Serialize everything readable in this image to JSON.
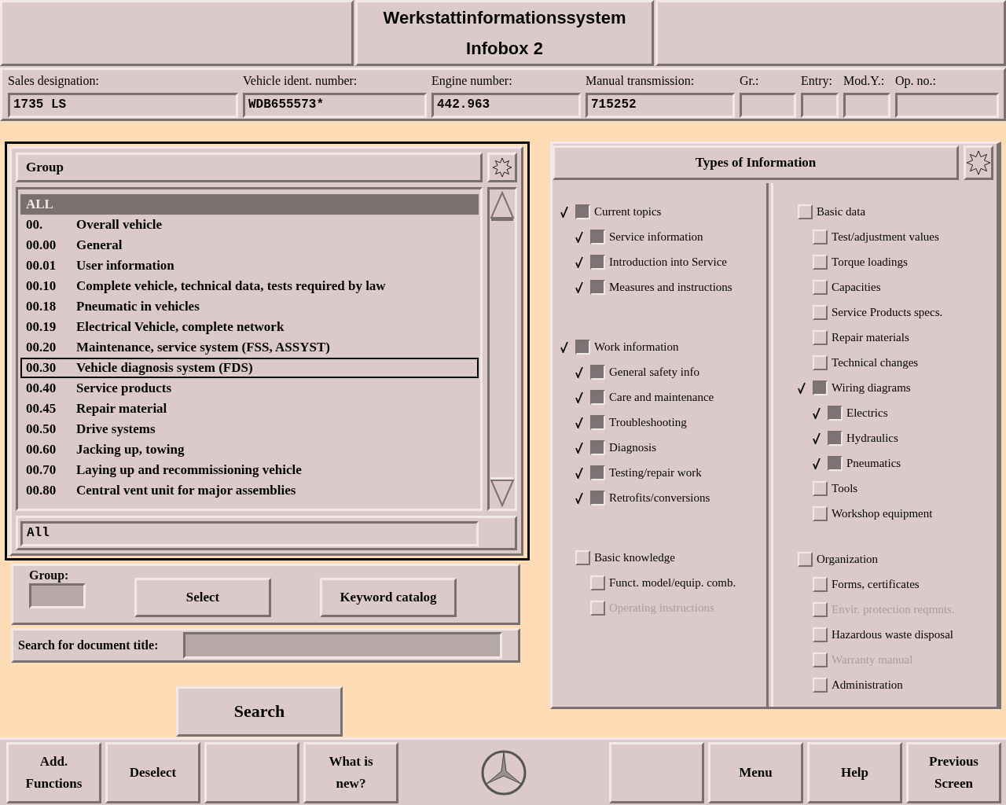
{
  "header": {
    "title": "Werkstattinformationssystem",
    "subtitle": "Infobox 2"
  },
  "vehicle_fields": [
    {
      "label": "Sales designation:",
      "value": "1735 LS"
    },
    {
      "label": "Vehicle ident. number:",
      "value": "WDB655573*"
    },
    {
      "label": "Engine number:",
      "value": "442.963"
    },
    {
      "label": "Manual transmission:",
      "value": "715252"
    },
    {
      "label": "Gr.:"
    },
    {
      "label": "Entry:"
    },
    {
      "label": "Mod.Y.:"
    },
    {
      "label": "Op. no.:"
    }
  ],
  "group_list": {
    "header": "Group",
    "filter_value": "All",
    "items": [
      {
        "code": "ALL",
        "selected": true,
        "focused": false
      },
      {
        "code": "00.",
        "title": "Overall vehicle",
        "selected": false,
        "focused": false
      },
      {
        "code": "00.00",
        "title": "General",
        "selected": false,
        "focused": false
      },
      {
        "code": "00.01",
        "title": "User information",
        "selected": false,
        "focused": false
      },
      {
        "code": "00.10",
        "title": "Complete vehicle, technical data, tests required by law",
        "selected": false,
        "focused": false
      },
      {
        "code": "00.18",
        "title": "Pneumatic in vehicles",
        "selected": false,
        "focused": false
      },
      {
        "code": "00.19",
        "title": "Electrical Vehicle, complete network",
        "selected": false,
        "focused": false
      },
      {
        "code": "00.20",
        "title": "Maintenance, service system (FSS, ASSYST)",
        "selected": false,
        "focused": false
      },
      {
        "code": "00.30",
        "title": "Vehicle diagnosis system (FDS)",
        "selected": false,
        "focused": true
      },
      {
        "code": "00.40",
        "title": "Service products",
        "selected": false,
        "focused": false
      },
      {
        "code": "00.45",
        "title": "Repair material",
        "selected": false,
        "focused": false
      },
      {
        "code": "00.50",
        "title": "Drive systems",
        "selected": false,
        "focused": false
      },
      {
        "code": "00.60",
        "title": "Jacking up, towing",
        "selected": false,
        "focused": false
      },
      {
        "code": "00.70",
        "title": "Laying up and recommissioning vehicle",
        "selected": false,
        "focused": false
      },
      {
        "code": "00.80",
        "title": "Central vent unit for major assemblies",
        "selected": false,
        "focused": false
      }
    ]
  },
  "group_controls": {
    "group_label": "Group:",
    "buttons": [
      "Select",
      "Keyword catalog"
    ]
  },
  "title_search": {
    "label": "Search for document title:"
  },
  "search_button": "Search",
  "info_types": {
    "title": "Types of Information",
    "columns": [
      {
        "items": [
          {
            "label": "Current topics",
            "checked": true,
            "disabled": false,
            "children": [
              {
                "label": "Service information",
                "checked": true,
                "disabled": false
              },
              {
                "label": "Introduction into Service",
                "checked": true,
                "disabled": false
              },
              {
                "label": "Measures and instructions",
                "checked": true,
                "disabled": false
              }
            ]
          },
          {
            "label": "Work information",
            "checked": true,
            "disabled": false,
            "children": [
              {
                "label": "General safety info",
                "checked": true,
                "disabled": false
              },
              {
                "label": "Care and maintenance",
                "checked": true,
                "disabled": false
              },
              {
                "label": "Troubleshooting",
                "checked": true,
                "disabled": false
              },
              {
                "label": "Diagnosis",
                "checked": true,
                "disabled": false
              },
              {
                "label": "Testing/repair work",
                "checked": true,
                "disabled": false
              },
              {
                "label": "Retrofits/conversions",
                "checked": true,
                "disabled": false
              }
            ]
          },
          {
            "label": "Basic knowledge",
            "checked": false,
            "disabled": false,
            "children": [
              {
                "label": "Funct. model/equip. comb.",
                "checked": false,
                "disabled": false
              },
              {
                "label": "Operating instructions",
                "checked": false,
                "disabled": true
              }
            ]
          }
        ]
      },
      {
        "items": [
          {
            "label": "Basic data",
            "checked": false,
            "disabled": false,
            "children": [
              {
                "label": "Test/adjustment values",
                "checked": false,
                "disabled": false
              },
              {
                "label": "Torque loadings",
                "checked": false,
                "disabled": false
              },
              {
                "label": "Capacities",
                "checked": false,
                "disabled": false
              },
              {
                "label": "Service Products specs.",
                "checked": false,
                "disabled": false
              },
              {
                "label": "Repair materials",
                "checked": false,
                "disabled": false
              },
              {
                "label": "Technical changes",
                "checked": false,
                "disabled": false
              },
              {
                "label": "Wiring diagrams",
                "checked": true,
                "disabled": false,
                "children": [
                  {
                    "label": "Electrics",
                    "checked": true,
                    "disabled": false
                  },
                  {
                    "label": "Hydraulics",
                    "checked": true,
                    "disabled": false
                  },
                  {
                    "label": "Pneumatics",
                    "checked": true,
                    "disabled": false
                  }
                ]
              },
              {
                "label": "Tools",
                "checked": false,
                "disabled": false
              },
              {
                "label": "Workshop equipment",
                "checked": false,
                "disabled": false
              }
            ]
          },
          {
            "label": "Organization",
            "checked": false,
            "disabled": false,
            "children": [
              {
                "label": "Forms, certificates",
                "checked": false,
                "disabled": false
              },
              {
                "label": "Envir. protection reqmnts.",
                "checked": false,
                "disabled": true
              },
              {
                "label": "Hazardous waste disposal",
                "checked": false,
                "disabled": false
              },
              {
                "label": "Warranty manual",
                "checked": false,
                "disabled": true
              },
              {
                "label": "Administration",
                "checked": false,
                "disabled": false
              }
            ]
          }
        ]
      }
    ]
  },
  "footer_buttons": [
    {
      "kind": "button",
      "lines": [
        "Add.",
        "Functions"
      ]
    },
    {
      "kind": "button",
      "lines": [
        "Deselect"
      ]
    },
    {
      "kind": "blank"
    },
    {
      "kind": "button",
      "lines": [
        "What is",
        "new?"
      ]
    },
    {
      "kind": "logo"
    },
    {
      "kind": "blank"
    },
    {
      "kind": "button",
      "lines": [
        "Menu"
      ]
    },
    {
      "kind": "button",
      "lines": [
        "Help"
      ]
    },
    {
      "kind": "button",
      "lines": [
        "Previous",
        "Screen"
      ]
    }
  ]
}
